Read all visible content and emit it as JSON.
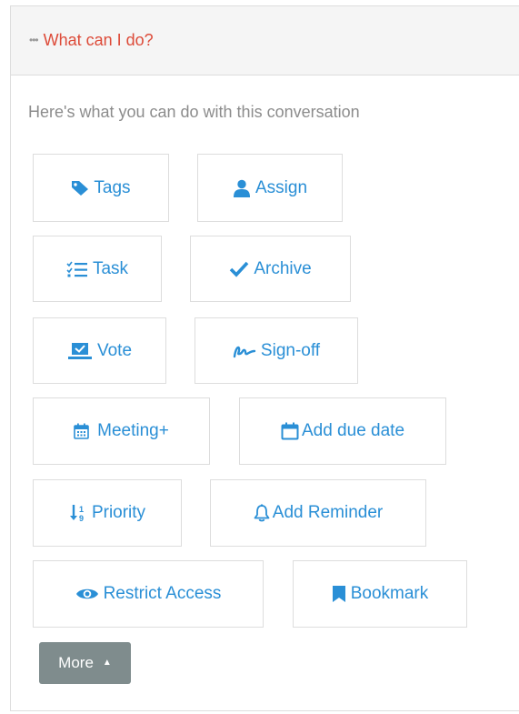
{
  "header": {
    "dots": "•••",
    "title": "What can I do?"
  },
  "intro": "Here's what you can do with this conversation",
  "actions": {
    "tags": {
      "label": "Tags",
      "icon": "tag-icon"
    },
    "assign": {
      "label": "Assign",
      "icon": "user-icon"
    },
    "task": {
      "label": "Task",
      "icon": "checklist-icon"
    },
    "archive": {
      "label": "Archive",
      "icon": "checkmark-icon"
    },
    "vote": {
      "label": "Vote",
      "icon": "ballot-icon"
    },
    "signoff": {
      "label": "Sign-off",
      "icon": "signature-icon"
    },
    "meeting": {
      "label": "Meeting+",
      "icon": "calendar-grid-icon"
    },
    "due_date": {
      "label": "Add due date",
      "icon": "calendar-icon"
    },
    "priority": {
      "label": "Priority",
      "icon": "sort-icon"
    },
    "reminder": {
      "label": "Add Reminder",
      "icon": "bell-icon"
    },
    "restrict": {
      "label": "Restrict Access",
      "icon": "eye-icon"
    },
    "bookmark": {
      "label": "Bookmark",
      "icon": "bookmark-icon"
    }
  },
  "more_button": {
    "label": "More",
    "caret": "▲"
  },
  "colors": {
    "accent": "#2a8fd6",
    "header_title": "#dd4b39",
    "more_bg": "#7f8c8d"
  }
}
